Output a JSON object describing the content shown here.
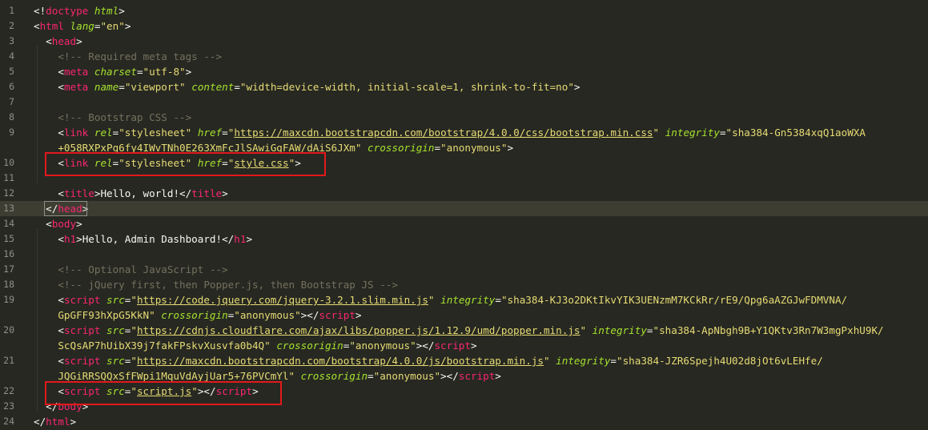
{
  "editor": {
    "lines": [
      {
        "n": "1",
        "parts": [
          [
            "pun",
            "<!"
          ],
          [
            "kw-tag",
            "doctype"
          ],
          [
            "txt",
            " "
          ],
          [
            "attr",
            "html"
          ],
          [
            "pun",
            ">"
          ]
        ]
      },
      {
        "n": "2",
        "parts": [
          [
            "pun",
            "<"
          ],
          [
            "kw-tag",
            "html"
          ],
          [
            "txt",
            " "
          ],
          [
            "attr",
            "lang"
          ],
          [
            "pun",
            "="
          ],
          [
            "str",
            "\"en\""
          ],
          [
            "pun",
            ">"
          ]
        ]
      },
      {
        "n": "3",
        "parts": [
          [
            "txt",
            "  "
          ],
          [
            "pun",
            "<"
          ],
          [
            "kw-tag",
            "head"
          ],
          [
            "pun",
            ">"
          ]
        ]
      },
      {
        "n": "4",
        "parts": [
          [
            "txt",
            "    "
          ],
          [
            "cmt",
            "<!-- Required meta tags -->"
          ]
        ]
      },
      {
        "n": "5",
        "parts": [
          [
            "txt",
            "    "
          ],
          [
            "pun",
            "<"
          ],
          [
            "kw-tag",
            "meta"
          ],
          [
            "txt",
            " "
          ],
          [
            "attr",
            "charset"
          ],
          [
            "pun",
            "="
          ],
          [
            "str",
            "\"utf-8\""
          ],
          [
            "pun",
            ">"
          ]
        ]
      },
      {
        "n": "6",
        "parts": [
          [
            "txt",
            "    "
          ],
          [
            "pun",
            "<"
          ],
          [
            "kw-tag",
            "meta"
          ],
          [
            "txt",
            " "
          ],
          [
            "attr",
            "name"
          ],
          [
            "pun",
            "="
          ],
          [
            "str",
            "\"viewport\""
          ],
          [
            "txt",
            " "
          ],
          [
            "attr",
            "content"
          ],
          [
            "pun",
            "="
          ],
          [
            "str",
            "\"width=device-width, initial-scale=1, shrink-to-fit=no\""
          ],
          [
            "pun",
            ">"
          ]
        ]
      },
      {
        "n": "7",
        "parts": []
      },
      {
        "n": "8",
        "parts": [
          [
            "txt",
            "    "
          ],
          [
            "cmt",
            "<!-- Bootstrap CSS -->"
          ]
        ]
      },
      {
        "n": "9",
        "parts": [
          [
            "txt",
            "    "
          ],
          [
            "pun",
            "<"
          ],
          [
            "kw-tag",
            "link"
          ],
          [
            "txt",
            " "
          ],
          [
            "attr",
            "rel"
          ],
          [
            "pun",
            "="
          ],
          [
            "str",
            "\"stylesheet\""
          ],
          [
            "txt",
            " "
          ],
          [
            "attr",
            "href"
          ],
          [
            "pun",
            "="
          ],
          [
            "str",
            "\""
          ],
          [
            "str u",
            "https://maxcdn.bootstrapcdn.com/bootstrap/4.0.0/css/bootstrap.min.css"
          ],
          [
            "str",
            "\""
          ],
          [
            "txt",
            " "
          ],
          [
            "attr",
            "integrity"
          ],
          [
            "pun",
            "="
          ],
          [
            "str",
            "\"sha384-Gn5384xqQ1aoWXA"
          ]
        ]
      },
      {
        "n": "",
        "parts": [
          [
            "txt",
            "    "
          ],
          [
            "str",
            "+058RXPxPg6fy4IWvTNh0E263XmFcJlSAwiGgFAW/dAiS6JXm\""
          ],
          [
            "txt",
            " "
          ],
          [
            "attr",
            "crossorigin"
          ],
          [
            "pun",
            "="
          ],
          [
            "str",
            "\"anonymous\""
          ],
          [
            "pun",
            ">"
          ]
        ]
      },
      {
        "n": "10",
        "parts": [
          [
            "txt",
            "    "
          ],
          [
            "pun",
            "<"
          ],
          [
            "kw-tag",
            "link"
          ],
          [
            "txt",
            " "
          ],
          [
            "attr",
            "rel"
          ],
          [
            "pun",
            "="
          ],
          [
            "str",
            "\"stylesheet\""
          ],
          [
            "txt",
            " "
          ],
          [
            "attr",
            "href"
          ],
          [
            "pun",
            "="
          ],
          [
            "str",
            "\""
          ],
          [
            "str u",
            "style.css"
          ],
          [
            "str",
            "\""
          ],
          [
            "pun",
            ">"
          ]
        ]
      },
      {
        "n": "11",
        "parts": []
      },
      {
        "n": "12",
        "parts": [
          [
            "txt",
            "    "
          ],
          [
            "pun",
            "<"
          ],
          [
            "kw-tag",
            "title"
          ],
          [
            "pun",
            ">"
          ],
          [
            "txt",
            "Hello, world!"
          ],
          [
            "pun",
            "</"
          ],
          [
            "kw-tag",
            "title"
          ],
          [
            "pun",
            ">"
          ]
        ]
      },
      {
        "n": "13",
        "parts": [
          [
            "txt",
            "  "
          ],
          [
            "pun",
            "</"
          ],
          [
            "kw-tag",
            "head"
          ],
          [
            "pun",
            ">"
          ]
        ]
      },
      {
        "n": "14",
        "parts": [
          [
            "txt",
            "  "
          ],
          [
            "pun",
            "<"
          ],
          [
            "kw-tag",
            "body"
          ],
          [
            "pun",
            ">"
          ]
        ]
      },
      {
        "n": "15",
        "parts": [
          [
            "txt",
            "    "
          ],
          [
            "pun",
            "<"
          ],
          [
            "kw-tag",
            "h1"
          ],
          [
            "pun",
            ">"
          ],
          [
            "txt",
            "Hello, Admin Dashboard!"
          ],
          [
            "pun",
            "</"
          ],
          [
            "kw-tag",
            "h1"
          ],
          [
            "pun",
            ">"
          ]
        ]
      },
      {
        "n": "16",
        "parts": []
      },
      {
        "n": "17",
        "parts": [
          [
            "txt",
            "    "
          ],
          [
            "cmt",
            "<!-- Optional JavaScript -->"
          ]
        ]
      },
      {
        "n": "18",
        "parts": [
          [
            "txt",
            "    "
          ],
          [
            "cmt",
            "<!-- jQuery first, then Popper.js, then Bootstrap JS -->"
          ]
        ]
      },
      {
        "n": "19",
        "parts": [
          [
            "txt",
            "    "
          ],
          [
            "pun",
            "<"
          ],
          [
            "kw-tag",
            "script"
          ],
          [
            "txt",
            " "
          ],
          [
            "attr",
            "src"
          ],
          [
            "pun",
            "="
          ],
          [
            "str",
            "\""
          ],
          [
            "str u",
            "https://code.jquery.com/jquery-3.2.1.slim.min.js"
          ],
          [
            "str",
            "\""
          ],
          [
            "txt",
            " "
          ],
          [
            "attr",
            "integrity"
          ],
          [
            "pun",
            "="
          ],
          [
            "str",
            "\"sha384-KJ3o2DKtIkvYIK3UENzmM7KCkRr/rE9/Qpg6aAZGJwFDMVNA/"
          ]
        ]
      },
      {
        "n": "",
        "parts": [
          [
            "txt",
            "    "
          ],
          [
            "str",
            "GpGFF93hXpG5KkN\""
          ],
          [
            "txt",
            " "
          ],
          [
            "attr",
            "crossorigin"
          ],
          [
            "pun",
            "="
          ],
          [
            "str",
            "\"anonymous\""
          ],
          [
            "pun",
            "></"
          ],
          [
            "kw-tag",
            "script"
          ],
          [
            "pun",
            ">"
          ]
        ]
      },
      {
        "n": "20",
        "parts": [
          [
            "txt",
            "    "
          ],
          [
            "pun",
            "<"
          ],
          [
            "kw-tag",
            "script"
          ],
          [
            "txt",
            " "
          ],
          [
            "attr",
            "src"
          ],
          [
            "pun",
            "="
          ],
          [
            "str",
            "\""
          ],
          [
            "str u",
            "https://cdnjs.cloudflare.com/ajax/libs/popper.js/1.12.9/umd/popper.min.js"
          ],
          [
            "str",
            "\""
          ],
          [
            "txt",
            " "
          ],
          [
            "attr",
            "integrity"
          ],
          [
            "pun",
            "="
          ],
          [
            "str",
            "\"sha384-ApNbgh9B+Y1QKtv3Rn7W3mgPxhU9K/"
          ]
        ]
      },
      {
        "n": "",
        "parts": [
          [
            "txt",
            "    "
          ],
          [
            "str",
            "ScQsAP7hUibX39j7fakFPskvXusvfa0b4Q\""
          ],
          [
            "txt",
            " "
          ],
          [
            "attr",
            "crossorigin"
          ],
          [
            "pun",
            "="
          ],
          [
            "str",
            "\"anonymous\""
          ],
          [
            "pun",
            "></"
          ],
          [
            "kw-tag",
            "script"
          ],
          [
            "pun",
            ">"
          ]
        ]
      },
      {
        "n": "21",
        "parts": [
          [
            "txt",
            "    "
          ],
          [
            "pun",
            "<"
          ],
          [
            "kw-tag",
            "script"
          ],
          [
            "txt",
            " "
          ],
          [
            "attr",
            "src"
          ],
          [
            "pun",
            "="
          ],
          [
            "str",
            "\""
          ],
          [
            "str u",
            "https://maxcdn.bootstrapcdn.com/bootstrap/4.0.0/js/bootstrap.min.js"
          ],
          [
            "str",
            "\""
          ],
          [
            "txt",
            " "
          ],
          [
            "attr",
            "integrity"
          ],
          [
            "pun",
            "="
          ],
          [
            "str",
            "\"sha384-JZR6Spejh4U02d8jOt6vLEHfe/"
          ]
        ]
      },
      {
        "n": "",
        "parts": [
          [
            "txt",
            "    "
          ],
          [
            "str",
            "JQGiRRSQQxSfFWpi1MquVdAyjUar5+76PVCmYl\""
          ],
          [
            "txt",
            " "
          ],
          [
            "attr",
            "crossorigin"
          ],
          [
            "pun",
            "="
          ],
          [
            "str",
            "\"anonymous\""
          ],
          [
            "pun",
            "></"
          ],
          [
            "kw-tag",
            "script"
          ],
          [
            "pun",
            ">"
          ]
        ]
      },
      {
        "n": "22",
        "parts": [
          [
            "txt",
            "    "
          ],
          [
            "pun",
            "<"
          ],
          [
            "kw-tag",
            "script"
          ],
          [
            "txt",
            " "
          ],
          [
            "attr",
            "src"
          ],
          [
            "pun",
            "="
          ],
          [
            "str",
            "\""
          ],
          [
            "str u",
            "script.js"
          ],
          [
            "str",
            "\""
          ],
          [
            "pun",
            "></"
          ],
          [
            "kw-tag",
            "script"
          ],
          [
            "pun",
            ">"
          ]
        ]
      },
      {
        "n": "23",
        "parts": [
          [
            "txt",
            "  "
          ],
          [
            "pun",
            "</"
          ],
          [
            "kw-tag",
            "body"
          ],
          [
            "pun",
            ">"
          ]
        ]
      },
      {
        "n": "24",
        "parts": [
          [
            "pun",
            "</"
          ],
          [
            "kw-tag",
            "html"
          ],
          [
            "pun",
            ">"
          ]
        ]
      }
    ],
    "current_line": "13",
    "highlighted_lines": [
      "10",
      "22"
    ],
    "colors": {
      "background": "#272822",
      "tag": "#f92672",
      "attribute": "#a6e22e",
      "string": "#e6db74",
      "comment": "#75715e",
      "text": "#f8f8f2",
      "highlight_box": "#e2191b"
    }
  }
}
